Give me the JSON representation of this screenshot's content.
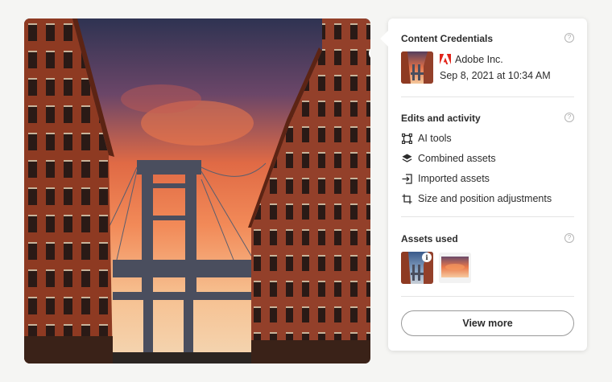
{
  "photo": {
    "info_icon": "info-icon"
  },
  "panel": {
    "credentials": {
      "title": "Content Credentials",
      "issuer": "Adobe Inc.",
      "date": "Sep 8, 2021 at 10:34 AM",
      "issuer_icon": "adobe-logo-icon",
      "brand_color": "#e1251b"
    },
    "edits": {
      "title": "Edits and activity",
      "items": [
        {
          "label": "AI tools",
          "icon": "ai-tools-icon"
        },
        {
          "label": "Combined assets",
          "icon": "layers-icon"
        },
        {
          "label": "Imported assets",
          "icon": "import-icon"
        },
        {
          "label": "Size and position adjustments",
          "icon": "crop-icon"
        }
      ]
    },
    "assets": {
      "title": "Assets used"
    },
    "view_more_label": "View more"
  },
  "colors": {
    "text": "#2c2c2c",
    "divider": "#e4e4e4",
    "background": "#f5f5f3"
  }
}
